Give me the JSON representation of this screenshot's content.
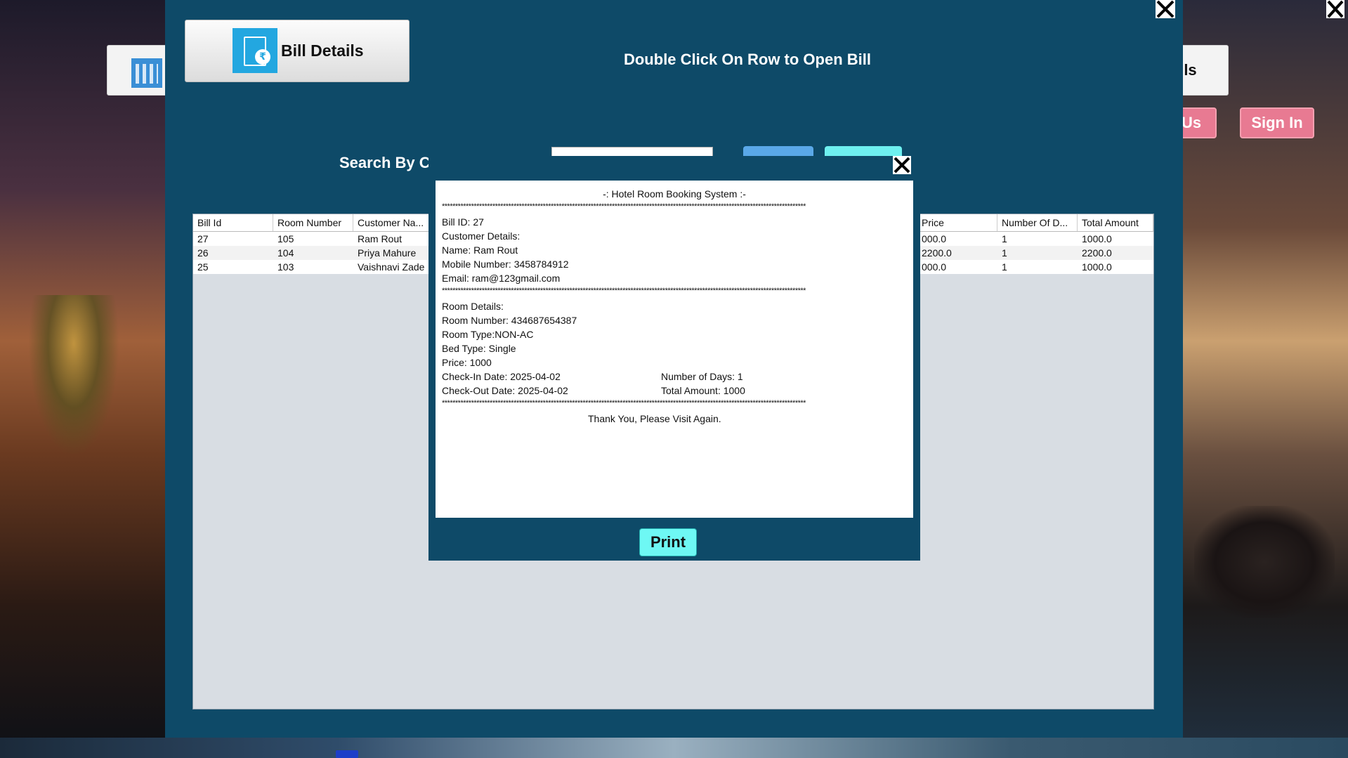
{
  "main": {
    "right_button_label": "ls",
    "pink_button_1": "Us",
    "pink_button_2": "Sign In"
  },
  "bill_window": {
    "title_button_label": "Bill Details",
    "hint": "Double Click On Row to Open Bill",
    "search_label": "Search By Cl"
  },
  "table": {
    "columns": [
      "Bill Id",
      "Room  Number",
      "Customer Na...",
      "Price",
      "Number Of D...",
      "Total Amount"
    ],
    "rows": [
      {
        "bill_id": "27",
        "room": "105",
        "customer": "Ram Rout",
        "price": "000.0",
        "days": "1",
        "total": "1000.0"
      },
      {
        "bill_id": "26",
        "room": "104",
        "customer": "Priya Mahure",
        "price": "2200.0",
        "days": "1",
        "total": "2200.0"
      },
      {
        "bill_id": "25",
        "room": "103",
        "customer": "Vaishnavi Zade",
        "price": "000.0",
        "days": "1",
        "total": "1000.0"
      }
    ]
  },
  "bill": {
    "header": "-: Hotel Room Booking System :-",
    "stars": "*****************************************************************************************************************************************",
    "bill_id": "Bill ID:  27",
    "customer_details": "Customer Details:",
    "name": "Name: Ram Rout",
    "mobile": "Mobile Number: 3458784912",
    "email": "Email: ram@123gmail.com",
    "room_details": "Room Details:",
    "room_number": "Room Number: 434687654387",
    "room_type": "Room Type:NON-AC",
    "bed_type": "Bed Type: Single",
    "price": "Price: 1000",
    "check_in": "Check-In Date: 2025-04-02",
    "days": "Number of Days: 1",
    "check_out": "Check-Out Date: 2025-04-02",
    "total": "Total Amount: 1000",
    "footer": "Thank You, Please Visit Again.",
    "print_label": "Print"
  }
}
